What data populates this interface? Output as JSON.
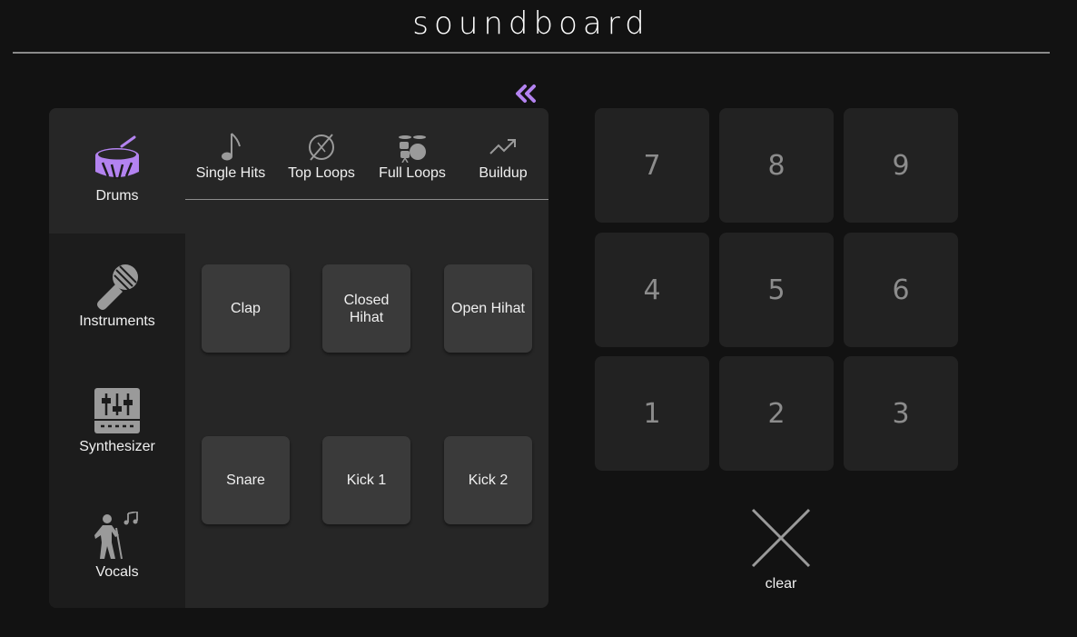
{
  "app": {
    "title": "soundboard",
    "accent": "#b383f0"
  },
  "collapse": {
    "icon": "double-chevron-left-icon"
  },
  "sidebar": {
    "items": [
      {
        "label": "Drums",
        "icon": "drum-icon",
        "active": true
      },
      {
        "label": "Instruments",
        "icon": "microphone-icon",
        "active": false
      },
      {
        "label": "Synthesizer",
        "icon": "mixer-sliders-icon",
        "active": false
      },
      {
        "label": "Vocals",
        "icon": "singer-icon",
        "active": false
      }
    ]
  },
  "tabs": [
    {
      "label": "Single Hits",
      "icon": "music-note-icon"
    },
    {
      "label": "Top Loops",
      "icon": "cymbal-icon"
    },
    {
      "label": "Full Loops",
      "icon": "drum-kit-icon"
    },
    {
      "label": "Buildup",
      "icon": "trending-up-icon"
    }
  ],
  "pads": [
    {
      "label": "Clap"
    },
    {
      "label": "Closed Hihat"
    },
    {
      "label": "Open Hihat"
    },
    {
      "label": "Snare"
    },
    {
      "label": "Kick 1"
    },
    {
      "label": "Kick 2"
    }
  ],
  "keypad": {
    "keys": [
      "7",
      "8",
      "9",
      "4",
      "5",
      "6",
      "1",
      "2",
      "3"
    ]
  },
  "clear": {
    "label": "clear",
    "icon": "close-icon"
  }
}
